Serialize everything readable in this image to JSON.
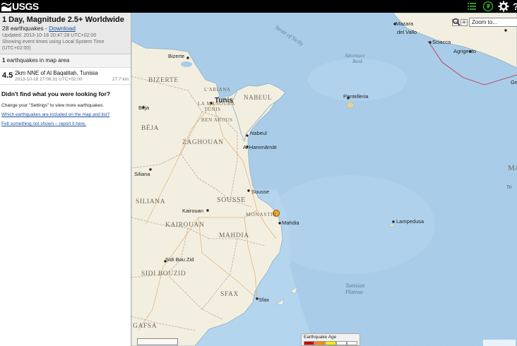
{
  "header": {
    "logo_text": "USGS",
    "buttons": [
      "list-icon",
      "globe-icon",
      "gear-icon",
      "help-icon"
    ],
    "accent_color": "#2f9a2f"
  },
  "sidebar": {
    "title": "1 Day, Magnitude 2.5+ Worldwide",
    "count_text": "28 earthquakes - ",
    "download_label": "Download",
    "updated": "Updated: 2013-10-18 20:47:28 UTC+02:00",
    "timezone": "Showing event times using Local System Time (UTC+02:00)",
    "in_area_count": "1",
    "in_area_text": " earthquakes in map area",
    "earthquakes": [
      {
        "mag": "4.5",
        "place": "2km NNE of Al Baqalitah, Tunisia",
        "time": "2013-10-18 17:08:31 UTC+02:00",
        "distance": "27.7 km"
      }
    ],
    "question": "Didn't find what you were looking for?",
    "settings_hint": "Change your \"Settings\" to view more earthquakes.",
    "link_included": "Which earthquakes are included on the map and list?",
    "link_report": "Felt something not shown – report it here."
  },
  "map": {
    "zoom_select": "Zoom to...",
    "legend_title": "Earthquake Age",
    "legend_colors": [
      "#cc0000",
      "#ff8800",
      "#ffee00",
      "#ffffff",
      "#ffffff"
    ],
    "land_color": "#f3efe0",
    "sea_color": "#a9cde9",
    "regions": [
      "BIZERTE",
      "L'ARIANA",
      "LA MANOUBA",
      "TUNIS",
      "BEN AROUS",
      "NABEUL",
      "BÉJA",
      "ZAGHOUAN",
      "SILIANA",
      "SOUSSE",
      "MONASTIR",
      "KAIROUAN",
      "MAHDIA",
      "SIDI BOUZID",
      "SFAX",
      "GAFSA"
    ],
    "cities": [
      "Bizerte",
      "Tunis",
      "Béja",
      "Nabeul",
      "Al Ḥammāmāt",
      "Siliana",
      "Sousse",
      "Kairouan",
      "Mahdia",
      "Sidi Bou Zid",
      "Sfax",
      "Pantelleria",
      "Lampedusa",
      "Mazara del Vallo",
      "Sciacca",
      "Agrigento",
      "Gela"
    ],
    "sea_labels": [
      "Strait of Sicily",
      "Adventure Bank",
      "Tunisian Plateau"
    ],
    "offmap_labels": [
      "MA",
      "Tri"
    ],
    "quake_color": "#f5a623"
  }
}
